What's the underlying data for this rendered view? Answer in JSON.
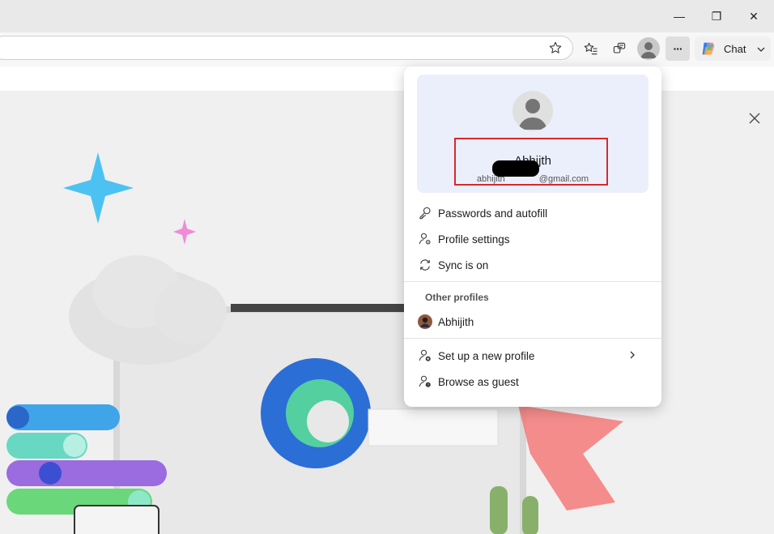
{
  "window": {
    "minimize_glyph": "—",
    "restore_glyph": "❐",
    "close_glyph": "✕"
  },
  "toolbar": {
    "chat_label": "Chat",
    "more_glyph": "···"
  },
  "profile_menu": {
    "name": "Abhijth",
    "email_visible_prefix": "abhijith",
    "email_visible_suffix": "@gmail.com",
    "items": [
      {
        "label": "Passwords and autofill",
        "icon": "key-icon"
      },
      {
        "label": "Profile settings",
        "icon": "profile-settings-icon"
      },
      {
        "label": "Sync is on",
        "icon": "sync-icon"
      }
    ],
    "other_profiles_label": "Other profiles",
    "other_profile_name": "Abhijith",
    "setup_label": "Set up a new profile",
    "guest_label": "Browse as guest"
  },
  "colors": {
    "highlight_border": "#d9272e",
    "profile_card_bg": "#ebeffb"
  }
}
